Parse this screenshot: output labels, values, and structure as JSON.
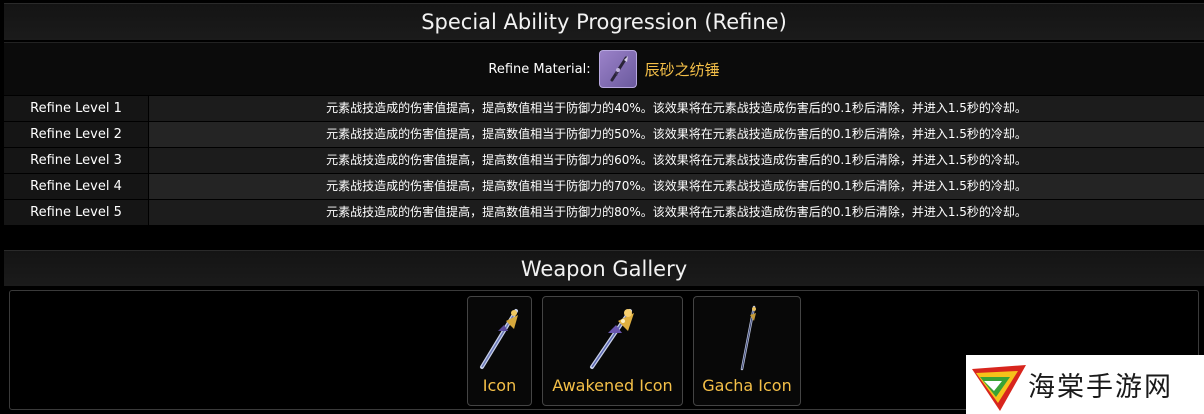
{
  "refine": {
    "title": "Special Ability Progression (Refine)",
    "material_label": "Refine Material:",
    "material_name": "辰砂之纺锤",
    "levels": [
      {
        "name": "Refine Level 1",
        "desc": "元素战技造成的伤害值提高，提高数值相当于防御力的40%。该效果将在元素战技造成伤害后的0.1秒后清除，并进入1.5秒的冷却。"
      },
      {
        "name": "Refine Level 2",
        "desc": "元素战技造成的伤害值提高，提高数值相当于防御力的50%。该效果将在元素战技造成伤害后的0.1秒后清除，并进入1.5秒的冷却。"
      },
      {
        "name": "Refine Level 3",
        "desc": "元素战技造成的伤害值提高，提高数值相当于防御力的60%。该效果将在元素战技造成伤害后的0.1秒后清除，并进入1.5秒的冷却。"
      },
      {
        "name": "Refine Level 4",
        "desc": "元素战技造成的伤害值提高，提高数值相当于防御力的70%。该效果将在元素战技造成伤害后的0.1秒后清除，并进入1.5秒的冷却。"
      },
      {
        "name": "Refine Level 5",
        "desc": "元素战技造成的伤害值提高，提高数值相当于防御力的80%。该效果将在元素战技造成伤害后的0.1秒后清除，并进入1.5秒的冷却。"
      }
    ]
  },
  "gallery": {
    "title": "Weapon Gallery",
    "items": [
      {
        "label": "Icon",
        "icon": "sword-icon"
      },
      {
        "label": "Awakened Icon",
        "icon": "sword-awakened-icon"
      },
      {
        "label": "Gacha Icon",
        "icon": "sword-gacha-icon"
      }
    ]
  },
  "watermark": {
    "text": "海棠手游网"
  },
  "colors": {
    "accent_gold": "#f5c048",
    "header_bg": "#161616",
    "row_bg": "#1c1c1c"
  }
}
